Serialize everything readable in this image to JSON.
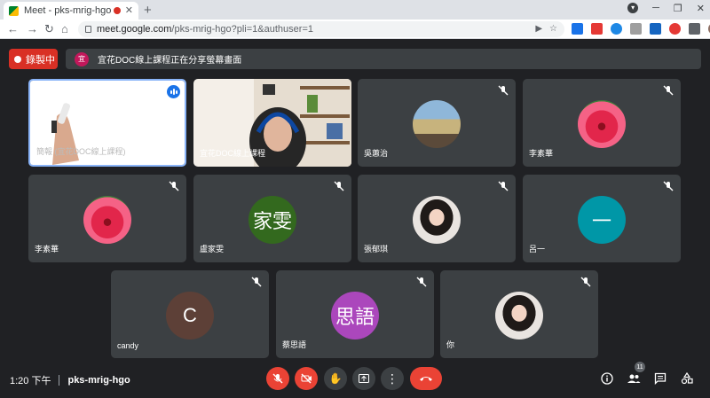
{
  "browser": {
    "tab_title": "Meet - pks-mrig-hgo",
    "url_host": "meet.google.com",
    "url_path": "/pks-mrig-hgo?pli=1&authuser=1"
  },
  "meeting": {
    "recording_label": "錄製中",
    "presenting_avatar_initial": "宜",
    "presenting_text": "宜花DOC線上課程正在分享螢幕畫面",
    "time": "1:20 下午",
    "code": "pks-mrig-hgo",
    "participant_count": "11"
  },
  "tiles": [
    {
      "name": "簡報 (宜花DOC線上課程)",
      "type": "presentation"
    },
    {
      "name": "宜花DOC線上課程",
      "type": "video"
    },
    {
      "name": "吳蕙治",
      "type": "photo",
      "style": "castle"
    },
    {
      "name": "李素華",
      "type": "photo",
      "style": "flower"
    },
    {
      "name": "李素華",
      "type": "photo",
      "style": "flower"
    },
    {
      "name": "盧家雯",
      "type": "initials",
      "initials": "家雯",
      "color": "#33691e"
    },
    {
      "name": "張郁琪",
      "type": "photo",
      "style": "girl"
    },
    {
      "name": "呂一",
      "type": "initials",
      "initials": "一",
      "color": "#0097a7"
    },
    {
      "name": "candy",
      "type": "initials",
      "initials": "C",
      "color": "#5d4037"
    },
    {
      "name": "蔡思語",
      "type": "initials",
      "initials": "思語",
      "color": "#ab47bc"
    },
    {
      "name": "你",
      "type": "photo",
      "style": "girl"
    }
  ],
  "colors": {
    "accent": "#1a73e8",
    "danger": "#ea4335",
    "tile": "#3c4043",
    "bg": "#202124"
  }
}
